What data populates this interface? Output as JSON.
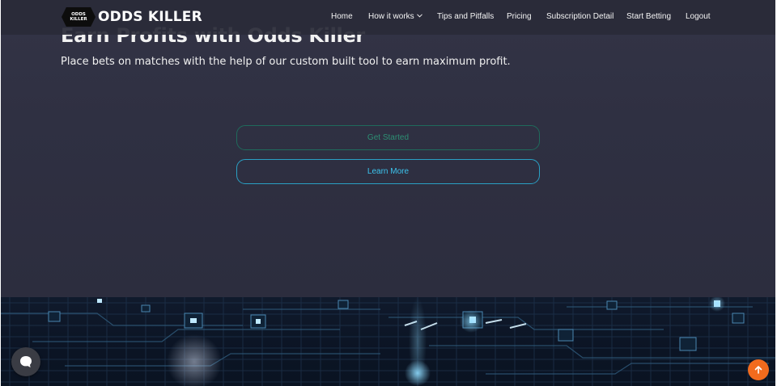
{
  "brand": {
    "logo_line1": "ODDS",
    "logo_line2": "KILLER",
    "name": "ODDS KILLER"
  },
  "nav": {
    "items": [
      {
        "label": "Home"
      },
      {
        "label": "How it works",
        "dropdown": true
      },
      {
        "label": "Tips and Pitfalls"
      },
      {
        "label": "Pricing"
      },
      {
        "label": "Subscription Detail"
      },
      {
        "label": "Start Betting"
      },
      {
        "label": "Logout"
      }
    ]
  },
  "hero": {
    "title": "Earn Profits with Odds Killer",
    "subtitle": "Place bets on matches with the help of our custom built tool to earn maximum profit.",
    "primary_button": "Get Started",
    "secondary_button": "Learn More"
  },
  "icons": {
    "chat": "chat-bubble-icon",
    "scroll_top": "arrow-up-icon",
    "dropdown": "chevron-down-icon"
  },
  "colors": {
    "background": "#2d2d3e",
    "navbar": "#2a2b38",
    "get_started": "#2d8f74",
    "learn_more": "#3cc4ee",
    "scroll_top": "#f26b1d"
  }
}
